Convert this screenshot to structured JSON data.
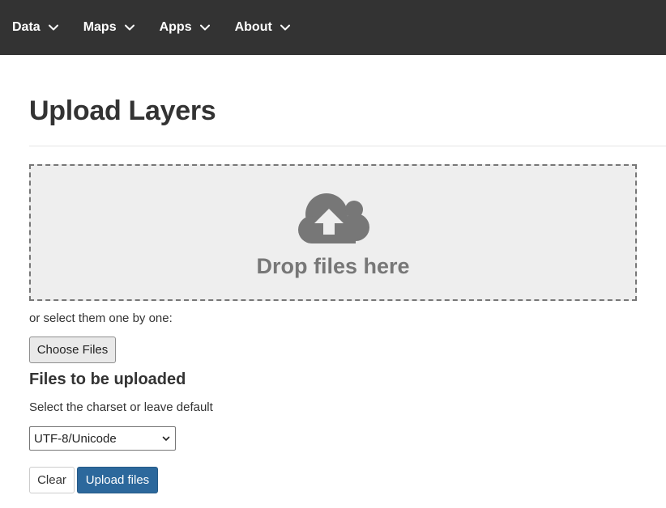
{
  "navbar": {
    "items": [
      {
        "label": "Data",
        "icon": "chevron-down-icon"
      },
      {
        "label": "Maps",
        "icon": "chevron-down-icon"
      },
      {
        "label": "Apps",
        "icon": "chevron-down-icon"
      },
      {
        "label": "About",
        "icon": "chevron-down-icon"
      }
    ]
  },
  "page": {
    "title": "Upload Layers"
  },
  "dropzone": {
    "icon": "cloud-upload-icon",
    "label": "Drop files here"
  },
  "file_picker": {
    "hint": "or select them one by one:",
    "button_label": "Choose Files"
  },
  "files_section": {
    "heading": "Files to be uploaded",
    "charset_hint": "Select the charset or leave default",
    "charset_selected": "UTF-8/Unicode"
  },
  "actions": {
    "clear_label": "Clear",
    "upload_label": "Upload files"
  },
  "colors": {
    "navbar_bg": "#333333",
    "dropzone_bg": "#eeeeee",
    "icon_gray": "#777777",
    "primary": "#2c689c"
  }
}
